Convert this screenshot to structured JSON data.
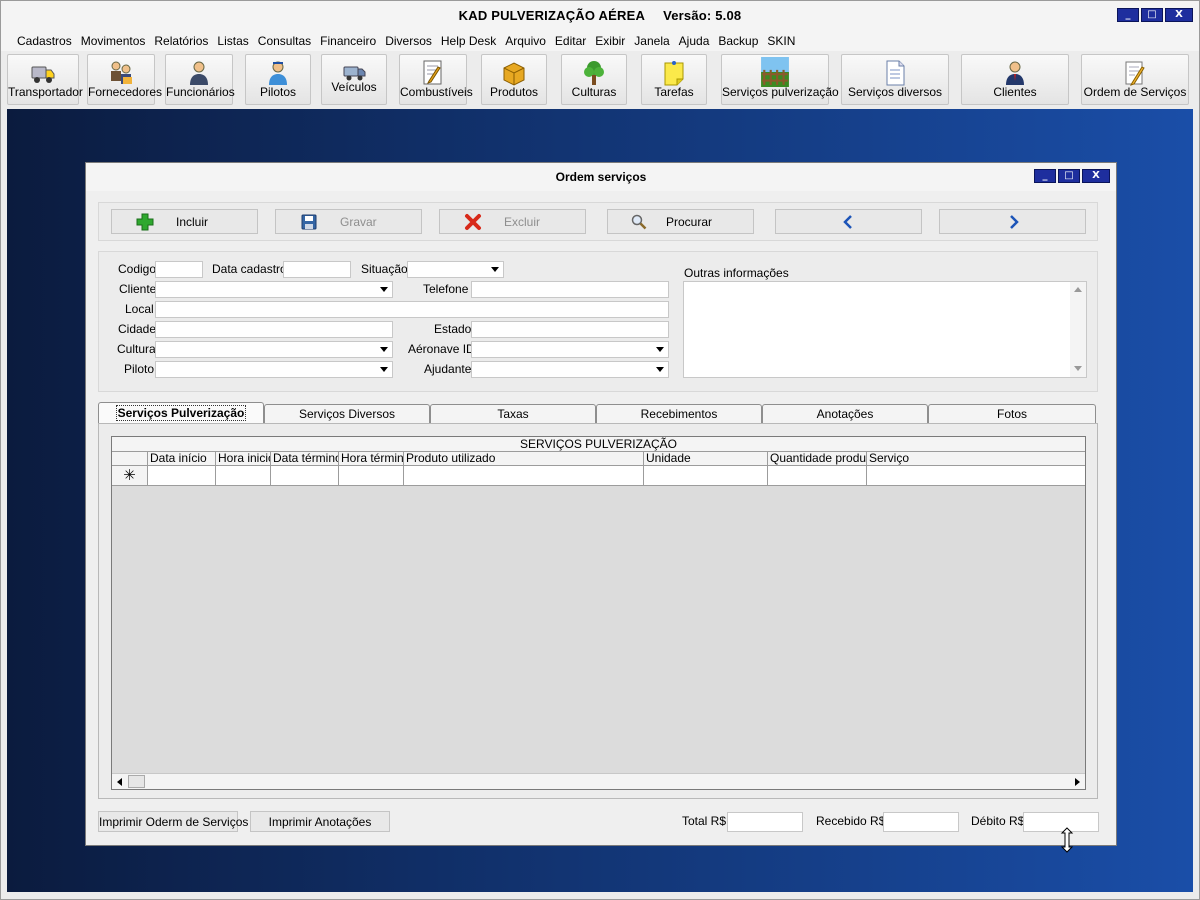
{
  "app": {
    "title": "KAD PULVERIZAÇÃO AÉREA",
    "version": "Versão: 5.08",
    "window_buttons": [
      "_",
      "□",
      "X"
    ]
  },
  "menu": [
    "Cadastros",
    "Movimentos",
    "Relatórios",
    "Listas",
    "Consultas",
    "Financeiro",
    "Diversos",
    "Help Desk",
    "Arquivo",
    "Editar",
    "Exibir",
    "Janela",
    "Ajuda",
    "Backup",
    "SKIN"
  ],
  "toolbar": [
    {
      "label": "Transportador",
      "icon": "truck-icon"
    },
    {
      "label": "Fornecedores",
      "icon": "suppliers-icon"
    },
    {
      "label": "Funcionários",
      "icon": "employee-icon"
    },
    {
      "label": "Pilotos",
      "icon": "pilot-icon"
    },
    {
      "label": "Veículos",
      "icon": "vehicle-icon"
    },
    {
      "label": "Combustíveis",
      "icon": "fuel-document-icon"
    },
    {
      "label": "Produtos",
      "icon": "box-icon"
    },
    {
      "label": "Culturas",
      "icon": "tree-icon"
    },
    {
      "label": "Tarefas",
      "icon": "sticky-note-icon"
    },
    {
      "label": "Serviços pulverização",
      "icon": "field-fence-icon"
    },
    {
      "label": "Serviços diversos",
      "icon": "document-icon"
    },
    {
      "label": "Clientes",
      "icon": "client-icon"
    },
    {
      "label": "Ordem de Serviços",
      "icon": "pencil-document-icon"
    }
  ],
  "child": {
    "title": "Ordem serviços",
    "window_buttons": [
      "_",
      "□",
      "X"
    ]
  },
  "actions": {
    "incluir": "Incluir",
    "gravar": "Gravar",
    "excluir": "Excluir",
    "procurar": "Procurar",
    "prev": "‹",
    "next": "›"
  },
  "form": {
    "codigo": "Codigo",
    "data_cadastro": "Data cadastro",
    "situacao": "Situação",
    "cliente": "Cliente",
    "telefone": "Telefone",
    "local": "Local",
    "cidade": "Cidade",
    "estado": "Estado",
    "cultura": "Cultura",
    "aeronave": "Aéronave ID",
    "piloto": "Piloto",
    "ajudante": "Ajudante",
    "outras_info": "Outras informações"
  },
  "tabs": [
    "Serviços Pulverização",
    "Serviços Diversos",
    "Taxas",
    "Recebimentos",
    "Anotações",
    "Fotos"
  ],
  "grid": {
    "caption": "SERVIÇOS PULVERIZAÇÃO",
    "columns": [
      "Data início",
      "Hora inicio",
      "Data término",
      "Hora término",
      "Produto utilizado",
      "Unidade",
      "Quantidade produto",
      "Serviço"
    ],
    "new_row_marker": "✳"
  },
  "bottom": {
    "print_order": "Imprimir Oderm  de Serviços",
    "print_notes": "Imprimir Anotações",
    "total": "Total R$",
    "recebido": "Recebido R$",
    "debito": "Débito R$"
  }
}
